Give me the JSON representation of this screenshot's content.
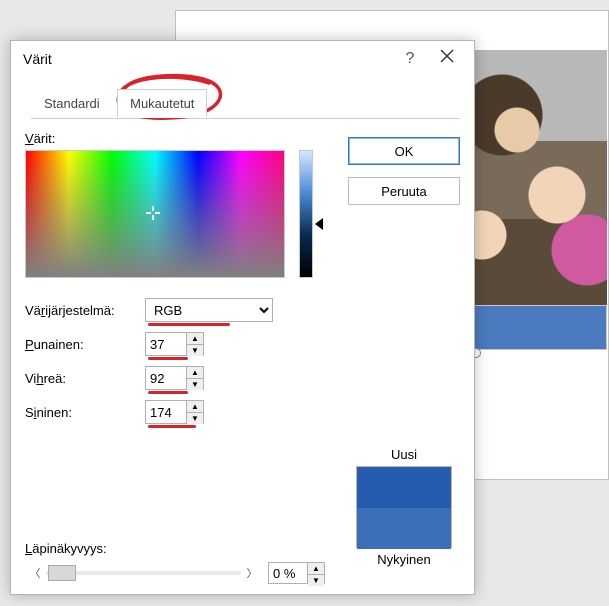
{
  "dialog": {
    "title": "Värit",
    "help_tooltip": "?",
    "tabs": {
      "standard": "Standardi",
      "custom": "Mukautetut"
    },
    "buttons": {
      "ok": "OK",
      "cancel": "Peruuta"
    },
    "colors_label": "Värit:",
    "color_model_label": "Värijärjestelmä:",
    "color_model_value": "RGB",
    "red_label": "Punainen:",
    "red_value": "37",
    "green_label": "Vihreä:",
    "green_value": "92",
    "blue_label": "Sininen:",
    "blue_value": "174",
    "new_label": "Uusi",
    "current_label": "Nykyinen",
    "transparency_label": "Läpinäkyvyys:",
    "transparency_value": "0 %",
    "colors": {
      "new": "#255cae",
      "current": "#3b6fb8",
      "accent_mark": "#d8232a"
    }
  }
}
